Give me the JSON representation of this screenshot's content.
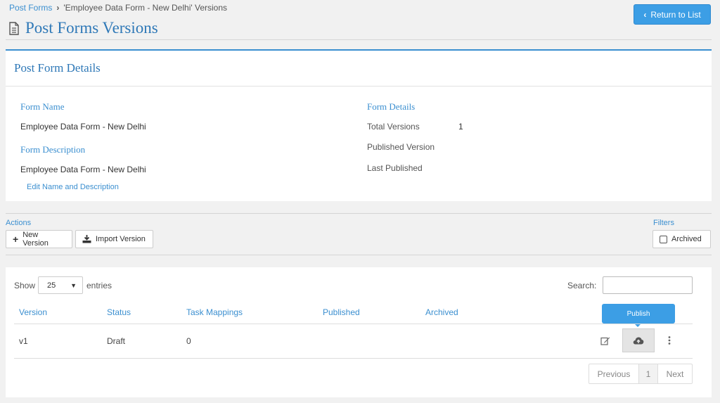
{
  "breadcrumb": {
    "root": "Post Forms",
    "current": "'Employee Data Form - New Delhi' Versions"
  },
  "page": {
    "title": "Post Forms Versions",
    "return_label": "Return to List"
  },
  "details": {
    "title": "Post Form Details",
    "form_name_label": "Form Name",
    "form_name": "Employee Data Form - New Delhi",
    "form_desc_label": "Form Description",
    "form_desc": "Employee Data Form - New Delhi",
    "edit_link": "Edit Name and Description",
    "form_details_label": "Form Details",
    "total_versions_label": "Total Versions",
    "total_versions": "1",
    "published_version_label": "Published Version",
    "last_published_label": "Last Published"
  },
  "actions": {
    "label": "Actions",
    "new_version": "New Version",
    "import_version": "Import Version"
  },
  "filters": {
    "label": "Filters",
    "archived": "Archived"
  },
  "table": {
    "show_label": "Show",
    "entries_value": "25",
    "entries_label": "entries",
    "search_label": "Search:",
    "columns": [
      "Version",
      "Status",
      "Task Mappings",
      "Published",
      "Archived"
    ],
    "rows": [
      {
        "version": "v1",
        "status": "Draft",
        "task_mappings": "0",
        "published": "",
        "archived": ""
      }
    ],
    "publish_tooltip": "Publish",
    "pager": {
      "previous": "Previous",
      "current": "1",
      "next": "Next"
    }
  }
}
